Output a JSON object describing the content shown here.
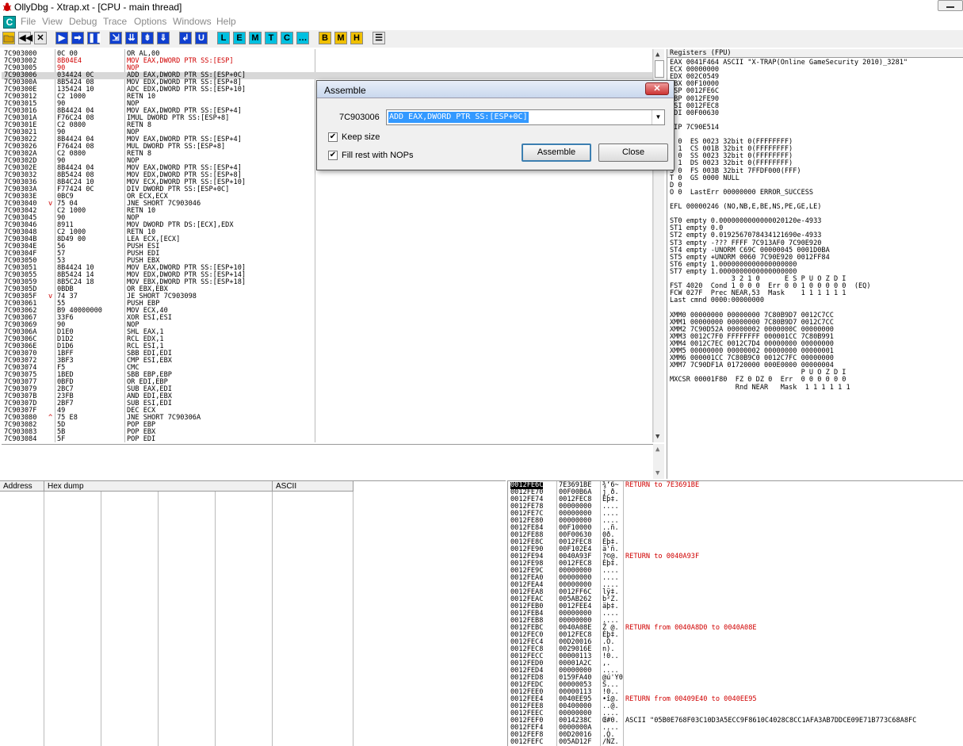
{
  "window": {
    "title": "OllyDbg - Xtrap.xt - [CPU - main thread]"
  },
  "menu": {
    "c_label": "C",
    "items": [
      "File",
      "View",
      "Debug",
      "Trace",
      "Options",
      "Windows",
      "Help"
    ]
  },
  "toolbar": {
    "buttons": [
      {
        "icon": "open-icon",
        "label": ""
      },
      {
        "icon": "rewind-icon",
        "label": "◀◀"
      },
      {
        "icon": "close-icon",
        "label": "✕"
      },
      {
        "icon": "run-icon",
        "label": "▶"
      },
      {
        "icon": "run-thread-icon",
        "label": "➡"
      },
      {
        "icon": "pause-icon",
        "label": "❚❚"
      },
      {
        "icon": "step-into-icon",
        "label": "⇲"
      },
      {
        "icon": "step-over-icon",
        "label": "⇊"
      },
      {
        "icon": "trace-into-icon",
        "label": "⇟"
      },
      {
        "icon": "trace-over-icon",
        "label": "⇓"
      },
      {
        "icon": "execute-till-return-icon",
        "label": "↲"
      },
      {
        "icon": "execute-till-user-icon",
        "label": "U"
      },
      {
        "icon": "",
        "label": "L"
      },
      {
        "icon": "",
        "label": "E"
      },
      {
        "icon": "",
        "label": "M"
      },
      {
        "icon": "",
        "label": "T"
      },
      {
        "icon": "",
        "label": "C"
      },
      {
        "icon": "",
        "label": "…"
      },
      {
        "icon": "",
        "label": "B"
      },
      {
        "icon": "",
        "label": "M"
      },
      {
        "icon": "",
        "label": "H"
      },
      {
        "icon": "list-icon",
        "label": "☰"
      }
    ]
  },
  "cpu": {
    "rows": [
      {
        "a": "7C903000",
        "j": "",
        "h": "0C 00",
        "s": "OR AL,00",
        "r": false,
        "hl": false
      },
      {
        "a": "7C903002",
        "j": "",
        "h": "8B04E4",
        "s": "MOV EAX,DWORD PTR SS:[ESP]",
        "r": true,
        "hl": false
      },
      {
        "a": "7C903005",
        "j": "",
        "h": "90",
        "s": "NOP",
        "r": true,
        "hl": false
      },
      {
        "a": "7C903006",
        "j": "",
        "h": "034424 0C",
        "s": "ADD EAX,DWORD PTR SS:[ESP+0C]",
        "r": false,
        "hl": true
      },
      {
        "a": "7C90300A",
        "j": "",
        "h": "8B5424 08",
        "s": "MOV EDX,DWORD PTR SS:[ESP+8]",
        "r": false,
        "hl": false
      },
      {
        "a": "7C90300E",
        "j": "",
        "h": "135424 10",
        "s": "ADC EDX,DWORD PTR SS:[ESP+10]",
        "r": false,
        "hl": false
      },
      {
        "a": "7C903012",
        "j": "",
        "h": "C2 1000",
        "s": "RETN 10",
        "r": false,
        "hl": false
      },
      {
        "a": "7C903015",
        "j": "",
        "h": "90",
        "s": "NOP",
        "r": false,
        "hl": false
      },
      {
        "a": "7C903016",
        "j": "",
        "h": "8B4424 04",
        "s": "MOV EAX,DWORD PTR SS:[ESP+4]",
        "r": false,
        "hl": false
      },
      {
        "a": "7C90301A",
        "j": "",
        "h": "F76C24 08",
        "s": "IMUL DWORD PTR SS:[ESP+8]",
        "r": false,
        "hl": false
      },
      {
        "a": "7C90301E",
        "j": "",
        "h": "C2 0800",
        "s": "RETN 8",
        "r": false,
        "hl": false
      },
      {
        "a": "7C903021",
        "j": "",
        "h": "90",
        "s": "NOP",
        "r": false,
        "hl": false
      },
      {
        "a": "7C903022",
        "j": "",
        "h": "8B4424 04",
        "s": "MOV EAX,DWORD PTR SS:[ESP+4]",
        "r": false,
        "hl": false
      },
      {
        "a": "7C903026",
        "j": "",
        "h": "F76424 08",
        "s": "MUL DWORD PTR SS:[ESP+8]",
        "r": false,
        "hl": false
      },
      {
        "a": "7C90302A",
        "j": "",
        "h": "C2 0800",
        "s": "RETN 8",
        "r": false,
        "hl": false
      },
      {
        "a": "7C90302D",
        "j": "",
        "h": "90",
        "s": "NOP",
        "r": false,
        "hl": false
      },
      {
        "a": "7C90302E",
        "j": "",
        "h": "8B4424 04",
        "s": "MOV EAX,DWORD PTR SS:[ESP+4]",
        "r": false,
        "hl": false
      },
      {
        "a": "7C903032",
        "j": "",
        "h": "8B5424 08",
        "s": "MOV EDX,DWORD PTR SS:[ESP+8]",
        "r": false,
        "hl": false
      },
      {
        "a": "7C903036",
        "j": "",
        "h": "8B4C24 10",
        "s": "MOV ECX,DWORD PTR SS:[ESP+10]",
        "r": false,
        "hl": false
      },
      {
        "a": "7C90303A",
        "j": "",
        "h": "F77424 0C",
        "s": "DIV DWORD PTR SS:[ESP+0C]",
        "r": false,
        "hl": false
      },
      {
        "a": "7C90303E",
        "j": "",
        "h": "0BC9",
        "s": "OR ECX,ECX",
        "r": false,
        "hl": false
      },
      {
        "a": "7C903040",
        "j": "v",
        "h": "75 04",
        "s": "JNE SHORT 7C903046",
        "r": false,
        "hl": false
      },
      {
        "a": "7C903042",
        "j": "",
        "h": "C2 1000",
        "s": "RETN 10",
        "r": false,
        "hl": false
      },
      {
        "a": "7C903045",
        "j": "",
        "h": "90",
        "s": "NOP",
        "r": false,
        "hl": false
      },
      {
        "a": "7C903046",
        "j": "",
        "h": "8911",
        "s": "MOV DWORD PTR DS:[ECX],EDX",
        "r": false,
        "hl": false
      },
      {
        "a": "7C903048",
        "j": "",
        "h": "C2 1000",
        "s": "RETN 10",
        "r": false,
        "hl": false
      },
      {
        "a": "7C90304B",
        "j": "",
        "h": "8D49 00",
        "s": "LEA ECX,[ECX]",
        "r": false,
        "hl": false
      },
      {
        "a": "7C90304E",
        "j": "",
        "h": "56",
        "s": "PUSH ESI",
        "r": false,
        "hl": false
      },
      {
        "a": "7C90304F",
        "j": "",
        "h": "57",
        "s": "PUSH EDI",
        "r": false,
        "hl": false
      },
      {
        "a": "7C903050",
        "j": "",
        "h": "53",
        "s": "PUSH EBX",
        "r": false,
        "hl": false
      },
      {
        "a": "7C903051",
        "j": "",
        "h": "8B4424 10",
        "s": "MOV EAX,DWORD PTR SS:[ESP+10]",
        "r": false,
        "hl": false
      },
      {
        "a": "7C903055",
        "j": "",
        "h": "8B5424 14",
        "s": "MOV EDX,DWORD PTR SS:[ESP+14]",
        "r": false,
        "hl": false
      },
      {
        "a": "7C903059",
        "j": "",
        "h": "8B5C24 18",
        "s": "MOV EBX,DWORD PTR SS:[ESP+18]",
        "r": false,
        "hl": false
      },
      {
        "a": "7C90305D",
        "j": "",
        "h": "0BDB",
        "s": "OR EBX,EBX",
        "r": false,
        "hl": false
      },
      {
        "a": "7C90305F",
        "j": "v",
        "h": "74 37",
        "s": "JE SHORT 7C903098",
        "r": false,
        "hl": false
      },
      {
        "a": "7C903061",
        "j": "",
        "h": "55",
        "s": "PUSH EBP",
        "r": false,
        "hl": false
      },
      {
        "a": "7C903062",
        "j": "",
        "h": "B9 40000000",
        "s": "MOV ECX,40",
        "r": false,
        "hl": false
      },
      {
        "a": "7C903067",
        "j": "",
        "h": "33F6",
        "s": "XOR ESI,ESI",
        "r": false,
        "hl": false
      },
      {
        "a": "7C903069",
        "j": "",
        "h": "90",
        "s": "NOP",
        "r": false,
        "hl": false
      },
      {
        "a": "7C90306A",
        "j": "",
        "h": "D1E0",
        "s": "SHL EAX,1",
        "r": false,
        "hl": false
      },
      {
        "a": "7C90306C",
        "j": "",
        "h": "D1D2",
        "s": "RCL EDX,1",
        "r": false,
        "hl": false
      },
      {
        "a": "7C90306E",
        "j": "",
        "h": "D1D6",
        "s": "RCL ESI,1",
        "r": false,
        "hl": false
      },
      {
        "a": "7C903070",
        "j": "",
        "h": "1BFF",
        "s": "SBB EDI,EDI",
        "r": false,
        "hl": false
      },
      {
        "a": "7C903072",
        "j": "",
        "h": "3BF3",
        "s": "CMP ESI,EBX",
        "r": false,
        "hl": false
      },
      {
        "a": "7C903074",
        "j": "",
        "h": "F5",
        "s": "CMC",
        "r": false,
        "hl": false
      },
      {
        "a": "7C903075",
        "j": "",
        "h": "1BED",
        "s": "SBB EBP,EBP",
        "r": false,
        "hl": false
      },
      {
        "a": "7C903077",
        "j": "",
        "h": "0BFD",
        "s": "OR EDI,EBP",
        "r": false,
        "hl": false
      },
      {
        "a": "7C903079",
        "j": "",
        "h": "2BC7",
        "s": "SUB EAX,EDI",
        "r": false,
        "hl": false
      },
      {
        "a": "7C90307B",
        "j": "",
        "h": "23FB",
        "s": "AND EDI,EBX",
        "r": false,
        "hl": false
      },
      {
        "a": "7C90307D",
        "j": "",
        "h": "2BF7",
        "s": "SUB ESI,EDI",
        "r": false,
        "hl": false
      },
      {
        "a": "7C90307F",
        "j": "",
        "h": "49",
        "s": "DEC ECX",
        "r": false,
        "hl": false
      },
      {
        "a": "7C903080",
        "j": "^",
        "h": "75 E8",
        "s": "JNE SHORT 7C90306A",
        "r": false,
        "hl": false
      },
      {
        "a": "7C903082",
        "j": "",
        "h": "5D",
        "s": "POP EBP",
        "r": false,
        "hl": false
      },
      {
        "a": "7C903083",
        "j": "",
        "h": "5B",
        "s": "POP EBX",
        "r": false,
        "hl": false
      },
      {
        "a": "7C903084",
        "j": "",
        "h": "5F",
        "s": "POP EDI",
        "r": false,
        "hl": false
      }
    ]
  },
  "registers": {
    "header": "Registers (FPU)",
    "lines": [
      "EAX 0041F464 ASCII \"X-TRAP(Online GameSecurity 2010)_3281\"",
      "ECX 00000000",
      "EDX 002C0549",
      "EBX 00F10000",
      "ESP 0012FE6C",
      "EBP 0012FE90",
      "ESI 0012FEC8",
      "EDI 00F00630",
      "",
      "EIP 7C90E514",
      "",
      "C 0  ES 0023 32bit 0(FFFFFFFF)",
      "P 1  CS 001B 32bit 0(FFFFFFFF)",
      "A 0  SS 0023 32bit 0(FFFFFFFF)",
      "Z 1  DS 0023 32bit 0(FFFFFFFF)",
      "S 0  FS 003B 32bit 7FFDF000(FFF)",
      "T 0  GS 0000 NULL",
      "D 0",
      "O 0  LastErr 00000000 ERROR_SUCCESS",
      "",
      "EFL 00000246 (NO,NB,E,BE,NS,PE,GE,LE)",
      "",
      "ST0 empty 0.0000000000000020120e-4933",
      "ST1 empty 0.0",
      "ST2 empty 0.0192567078434121690e-4933",
      "ST3 empty -??? FFFF 7C913AF0 7C90E920",
      "ST4 empty -UNORM C69C 00000045 0001D0BA",
      "ST5 empty +UNORM 0060 7C90E920 0012FF84",
      "ST6 empty 1.0000000000000000000",
      "ST7 empty 1.0000000000000000000",
      "               3 2 1 0      E S P U O Z D I",
      "FST 4020  Cond 1 0 0 0  Err 0 0 1 0 0 0 0 0  (EQ)",
      "FCW 027F  Prec NEAR,53  Mask    1 1 1 1 1 1",
      "Last cmnd 0000:00000000",
      "",
      "XMM0 00000000 00000000 7C80B9D7 0012C7CC",
      "XMM1 00000000 00000000 7C80B9D7 0012C7CC",
      "XMM2 7C90D52A 00000002 0000000C 00000000",
      "XMM3 0012C7F0 FFFFFFFF 000001CC 7C80B991",
      "XMM4 0012C7EC 0012C7D4 00000000 00000000",
      "XMM5 00000000 00000002 00000000 00000001",
      "XMM6 000001CC 7C80B9C0 0012C7FC 00000000",
      "XMM7 7C90DF1A 01720000 000E0000 00000004",
      "                                P U O Z D I",
      "MXCSR 00001F80  FZ 0 DZ 0  Err  0 0 0 0 0 0",
      "                Rnd NEAR   Mask  1 1 1 1 1 1"
    ]
  },
  "dump": {
    "headers": [
      "Address",
      "Hex dump",
      "ASCII"
    ]
  },
  "stack": {
    "rows": [
      {
        "a": "0012FE6C",
        "v": "7E3691BE",
        "s": "¾‘6~",
        "c": "RETURN to 7E3691BE"
      },
      {
        "a": "0012FE70",
        "v": "00F00B6A",
        "s": "j¸ð.",
        "c": ""
      },
      {
        "a": "0012FE74",
        "v": "0012FEC8",
        "s": "Èþ‡.",
        "c": ""
      },
      {
        "a": "0012FE78",
        "v": "00000000",
        "s": "....",
        "c": ""
      },
      {
        "a": "0012FE7C",
        "v": "00000000",
        "s": "....",
        "c": ""
      },
      {
        "a": "0012FE80",
        "v": "00000000",
        "s": "....",
        "c": ""
      },
      {
        "a": "0012FE84",
        "v": "00F10000",
        "s": "..ñ.",
        "c": ""
      },
      {
        "a": "0012FE88",
        "v": "00F00630",
        "s": "0ð.",
        "c": ""
      },
      {
        "a": "0012FE8C",
        "v": "0012FEC8",
        "s": "Èþ‡.",
        "c": ""
      },
      {
        "a": "0012FE90",
        "v": "00F102E4",
        "s": "ä'ñ.",
        "c": ""
      },
      {
        "a": "0012FE94",
        "v": "0040A93F",
        "s": "?©@.",
        "c": "RETURN to 0040A93F"
      },
      {
        "a": "0012FE98",
        "v": "0012FEC8",
        "s": "Èþ‡.",
        "c": ""
      },
      {
        "a": "0012FE9C",
        "v": "00000000",
        "s": "....",
        "c": ""
      },
      {
        "a": "0012FEA0",
        "v": "00000000",
        "s": "....",
        "c": ""
      },
      {
        "a": "0012FEA4",
        "v": "00000000",
        "s": "....",
        "c": ""
      },
      {
        "a": "0012FEA8",
        "v": "0012FF6C",
        "s": "lÿ‡.",
        "c": ""
      },
      {
        "a": "0012FEAC",
        "v": "005AB262",
        "s": "b²Z.",
        "c": ""
      },
      {
        "a": "0012FEB0",
        "v": "0012FEE4",
        "s": "äþ‡.",
        "c": ""
      },
      {
        "a": "0012FEB4",
        "v": "00000000",
        "s": "....",
        "c": ""
      },
      {
        "a": "0012FEB8",
        "v": "00000000",
        "s": "....",
        "c": ""
      },
      {
        "a": "0012FEBC",
        "v": "0040A08E",
        "s": "Ž @.",
        "c": "RETURN from 0040A8D0 to 0040A08E"
      },
      {
        "a": "0012FEC0",
        "v": "0012FEC8",
        "s": "Èþ‡.",
        "c": ""
      },
      {
        "a": "0012FEC4",
        "v": "00D20016",
        "s": ".Ò.",
        "c": ""
      },
      {
        "a": "0012FEC8",
        "v": "0029016E",
        "s": "n).",
        "c": ""
      },
      {
        "a": "0012FECC",
        "v": "00000113",
        "s": "!0..",
        "c": ""
      },
      {
        "a": "0012FED0",
        "v": "00001A2C",
        "s": ",.",
        "c": ""
      },
      {
        "a": "0012FED4",
        "v": "00000000",
        "s": "....",
        "c": ""
      },
      {
        "a": "0012FED8",
        "v": "0159FA40",
        "s": "@ú'Y0",
        "c": ""
      },
      {
        "a": "0012FEDC",
        "v": "00000053",
        "s": "S...",
        "c": ""
      },
      {
        "a": "0012FEE0",
        "v": "00000113",
        "s": "!0..",
        "c": ""
      },
      {
        "a": "0012FEE4",
        "v": "0040EE95",
        "s": "•î@.",
        "c": "RETURN from 00409E40 to 0040EE95"
      },
      {
        "a": "0012FEE8",
        "v": "00400000",
        "s": "..@.",
        "c": ""
      },
      {
        "a": "0012FEEC",
        "v": "00000000",
        "s": "....",
        "c": ""
      },
      {
        "a": "0012FEF0",
        "v": "0014238C",
        "s": "Œ#0.",
        "c": "ASCII \"05B0E768F03C10D3A5ECC9F8610C4028C8CC1AFA3AB7DDCE09E71B773C68A8FC"
      },
      {
        "a": "0012FEF4",
        "v": "0000000A",
        "s": "....",
        "c": ""
      },
      {
        "a": "0012FEF8",
        "v": "00D20016",
        "s": ".Ò.",
        "c": ""
      },
      {
        "a": "0012FEFC",
        "v": "005AD12F",
        "s": "/ÑZ.",
        "c": ""
      }
    ]
  },
  "dialog": {
    "title": "Assemble",
    "close_label": "✕",
    "address": "7C903006",
    "input_value": "ADD EAX,DWORD PTR SS:[ESP+0C]",
    "keep_size_label": "Keep size",
    "fill_nops_label": "Fill rest with NOPs",
    "check_mark": "✔",
    "assemble_label": "Assemble",
    "close_button_label": "Close"
  }
}
